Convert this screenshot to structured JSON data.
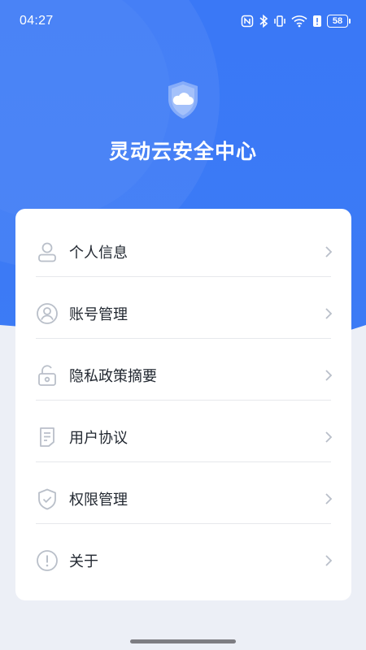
{
  "status_bar": {
    "time": "04:27",
    "battery": "58",
    "icons": [
      "nfc-icon",
      "bluetooth-icon",
      "vibrate-icon",
      "wifi-icon",
      "alert-icon",
      "battery-icon"
    ]
  },
  "header": {
    "logo": "shield-cloud-icon",
    "title": "灵动云安全中心"
  },
  "menu": {
    "items": [
      {
        "label": "个人信息",
        "icon": "person-icon"
      },
      {
        "label": "账号管理",
        "icon": "account-circle-icon"
      },
      {
        "label": "隐私政策摘要",
        "icon": "lock-icon"
      },
      {
        "label": "用户协议",
        "icon": "document-icon"
      },
      {
        "label": "权限管理",
        "icon": "shield-check-icon"
      },
      {
        "label": "关于",
        "icon": "info-icon"
      }
    ]
  },
  "colors": {
    "primary": "#3d7bf6",
    "primary_dark": "#2f67ee",
    "background": "#eceff6",
    "card": "#ffffff",
    "icon_gray": "#b9bfc9",
    "text": "#222831"
  }
}
